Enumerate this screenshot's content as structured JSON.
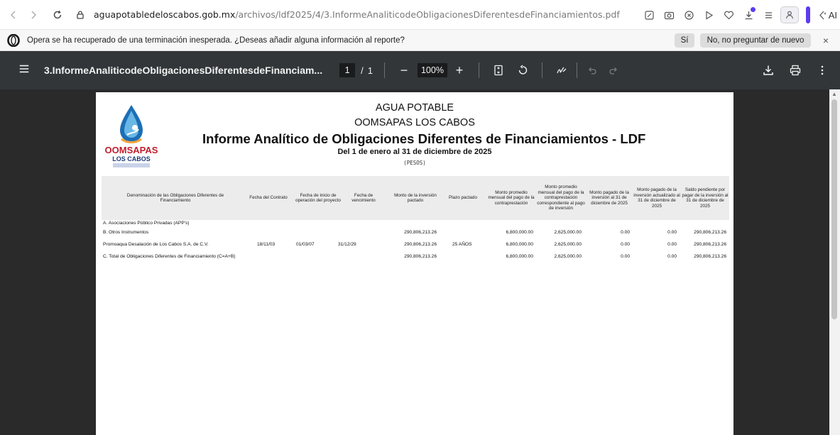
{
  "browser": {
    "url_domain": "aguapotabledeloscabos.gob.mx",
    "url_path": "/archivos/ldf2025/4/3.InformeAnaliticodeObligacionesDiferentesdeFinanciamientos.pdf",
    "ai_label": "AI"
  },
  "infobar": {
    "message": "Opera se ha recuperado de una terminación inesperada. ¿Deseas añadir alguna información al reporte?",
    "yes_label": "Sí",
    "no_label": "No, no preguntar de nuevo",
    "close_label": "×"
  },
  "pdf_toolbar": {
    "title": "3.InformeAnaliticodeObligacionesDiferentesdeFinanciam...",
    "current_page": "1",
    "page_separator": "/",
    "total_pages": "1",
    "zoom_out": "−",
    "zoom": "100%",
    "zoom_in": "+"
  },
  "report": {
    "org_line1": "AGUA POTABLE",
    "org_line2": "OOMSAPAS LOS CABOS",
    "title": "Informe Analítico de Obligaciones Diferentes de Financiamientos - LDF",
    "period": "Del 1 de enero al 31 de diciembre de 2025",
    "currency": "(PESOS)",
    "logo_line1": "OOMSAPAS",
    "logo_line2": "LOS CABOS",
    "headers": [
      "Denominación de las Obligaciones Diferentes de Financiamiento",
      "Fecha del Contrato",
      "Fecha de inicio de operación del proyecto",
      "Fecha de vencimiento",
      "Monto de la inversión pactado",
      "Plazo pactado",
      "Monto promedio mensual del pago de la contraprestación",
      "Monto promedio mensual del pago de la contraprestación correspondiente al pago de inversión",
      "Monto pagado de la inversión al 31 de diciembre de 2025",
      "Monto pagado de la inversión actualizado al 31 de diciembre de 2025",
      "Saldo pendiente por pagar de la inversión al 31 de diciembre de 2025"
    ],
    "rows": [
      {
        "name": "A. Asociaciones Público Privadas (APP's)",
        "contract": "",
        "start": "",
        "due": "",
        "amount": "",
        "term": "",
        "avg_payment": "",
        "avg_investment": "",
        "paid": "",
        "paid_updated": "",
        "balance": ""
      },
      {
        "name": "B. Otros Instrumentos",
        "contract": "",
        "start": "",
        "due": "",
        "amount": "290,806,213.26",
        "term": "",
        "avg_payment": "6,800,000.00",
        "avg_investment": "2,625,000.00",
        "paid": "0.00",
        "paid_updated": "0.00",
        "balance": "290,806,213.26"
      },
      {
        "name": "Promoaqua Desalación de Los Cabos S.A. de C.V.",
        "contract": "18/11/03",
        "start": "01/03/07",
        "due": "31/12/29",
        "amount": "290,806,213.26",
        "term": "25 AÑOS",
        "avg_payment": "6,800,000.00",
        "avg_investment": "2,625,000.00",
        "paid": "0.00",
        "paid_updated": "0.00",
        "balance": "290,806,213.26"
      },
      {
        "name": "C. Total de Obligaciones Diferentes de Financiamiento (C=A+B)",
        "contract": "",
        "start": "",
        "due": "",
        "amount": "290,806,213.26",
        "term": "",
        "avg_payment": "6,800,000.00",
        "avg_investment": "2,625,000.00",
        "paid": "0.00",
        "paid_updated": "0.00",
        "balance": "290,806,213.26"
      }
    ]
  }
}
